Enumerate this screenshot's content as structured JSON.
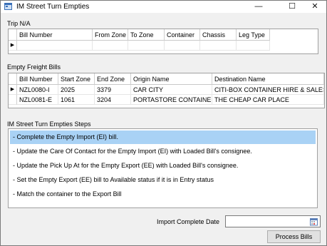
{
  "window": {
    "title": "IM Street Turn Empties"
  },
  "trip": {
    "group_label": "Trip N/A",
    "columns": [
      "Bill Number",
      "From Zone",
      "To Zone",
      "Container",
      "Chassis",
      "Leg Type"
    ]
  },
  "empty_bills": {
    "group_label": "Empty Freight Bills",
    "columns": [
      "Bill Number",
      "Start Zone",
      "End Zone",
      "Origin Name",
      "Destination Name"
    ],
    "rows": [
      [
        "NZL0080-I",
        "2025",
        "3379",
        "CAR CITY",
        "CITI-BOX CONTAINER HIRE & SALES"
      ],
      [
        "NZL0081-E",
        "1061",
        "3204",
        "PORTASTORE CONTAINERS",
        "THE CHEAP CAR PLACE"
      ]
    ]
  },
  "steps": {
    "group_label": "IM Street Turn Empties Steps",
    "items": [
      "- Complete the Empty Import (EI) bill.",
      "- Update the Care Of Contact for the Empty Import (EI) with Loaded Bill's consignee.",
      "- Update the Pick Up At for the Empty Export (EE) with Loaded Bill's consignee.",
      "- Set the Empty Export (EE) bill to Available status if it is in Entry status",
      "- Match the container to the Export Bill"
    ]
  },
  "import_complete": {
    "label": "Import Complete Date",
    "value": ""
  },
  "actions": {
    "process_label": "Process Bills"
  },
  "glyphs": {
    "minimize": "—",
    "maximize": "☐",
    "close": "✕",
    "row_pointer": "▶"
  },
  "colors": {
    "selection": "#a9d2f5"
  }
}
